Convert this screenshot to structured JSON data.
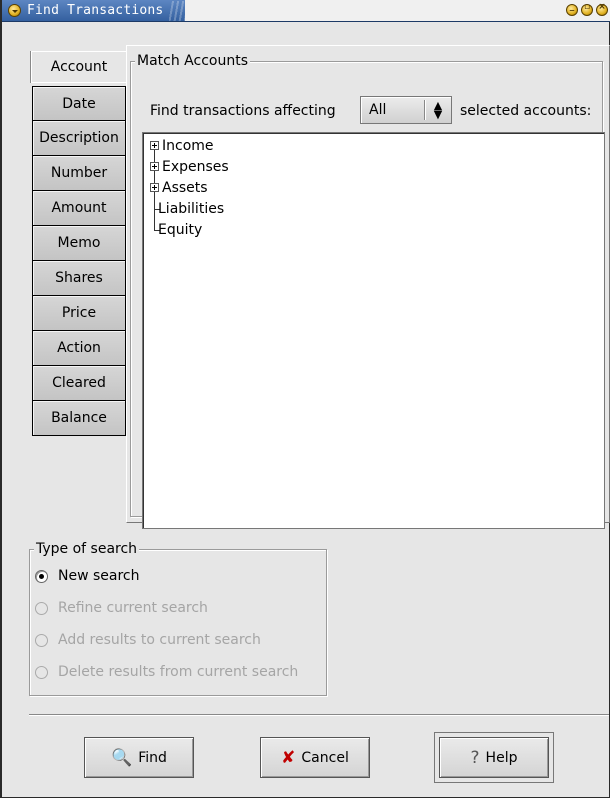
{
  "window": {
    "title": "Find Transactions"
  },
  "tabs": [
    {
      "label": "Account"
    },
    {
      "label": "Date"
    },
    {
      "label": "Description"
    },
    {
      "label": "Number"
    },
    {
      "label": "Amount"
    },
    {
      "label": "Memo"
    },
    {
      "label": "Shares"
    },
    {
      "label": "Price"
    },
    {
      "label": "Action"
    },
    {
      "label": "Cleared"
    },
    {
      "label": "Balance"
    }
  ],
  "match_accounts": {
    "legend": "Match Accounts",
    "affecting_label": "Find transactions affecting",
    "combo_value": "All",
    "selected_label": "selected accounts:",
    "tree": [
      {
        "label": "Income",
        "expandable": true
      },
      {
        "label": "Expenses",
        "expandable": true
      },
      {
        "label": "Assets",
        "expandable": true
      },
      {
        "label": "Liabilities",
        "expandable": false
      },
      {
        "label": "Equity",
        "expandable": false
      }
    ]
  },
  "search_type": {
    "legend": "Type of search",
    "options": [
      {
        "label": "New search",
        "checked": true,
        "enabled": true
      },
      {
        "label": "Refine current search",
        "checked": false,
        "enabled": false
      },
      {
        "label": "Add results to current search",
        "checked": false,
        "enabled": false
      },
      {
        "label": "Delete results from current search",
        "checked": false,
        "enabled": false
      }
    ]
  },
  "buttons": {
    "find": "Find",
    "cancel": "Cancel",
    "help": "Help"
  },
  "icons": {
    "find": "find-magnifier-icon",
    "cancel": "cancel-x-icon",
    "help": "help-question-icon"
  }
}
